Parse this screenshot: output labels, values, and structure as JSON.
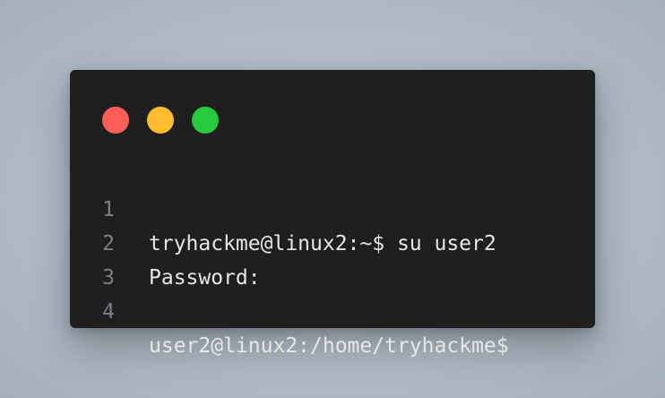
{
  "window": {
    "controls": [
      {
        "name": "close-dot",
        "color": "#ff5f56"
      },
      {
        "name": "minimize-dot",
        "color": "#ffbd2e"
      },
      {
        "name": "maximize-dot",
        "color": "#27c93f"
      }
    ],
    "lines": [
      {
        "number": "1",
        "text": "tryhackme@linux2:~$ su user2"
      },
      {
        "number": "2",
        "text": "Password:"
      },
      {
        "number": "3",
        "text": ""
      },
      {
        "number": "4",
        "text": "user2@linux2:/home/tryhackme$"
      }
    ]
  }
}
